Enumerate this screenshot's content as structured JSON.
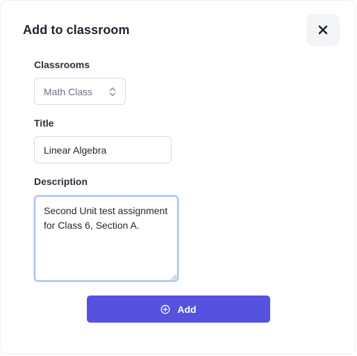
{
  "dialog": {
    "title": "Add to classroom",
    "close_icon": "x-icon"
  },
  "form": {
    "classrooms": {
      "label": "Classrooms",
      "selected": "Math Class",
      "icon": "chevron-up-down-icon"
    },
    "title": {
      "label": "Title",
      "value": "Linear Algebra"
    },
    "description": {
      "label": "Description",
      "value": "Second Unit test assignment for Class 6, Section A."
    },
    "submit": {
      "label": "Add",
      "icon": "plus-circle-icon"
    }
  },
  "colors": {
    "accent": "#5552df",
    "focus_ring": "#a9c3f5",
    "close_bg": "#f3f4f6"
  }
}
